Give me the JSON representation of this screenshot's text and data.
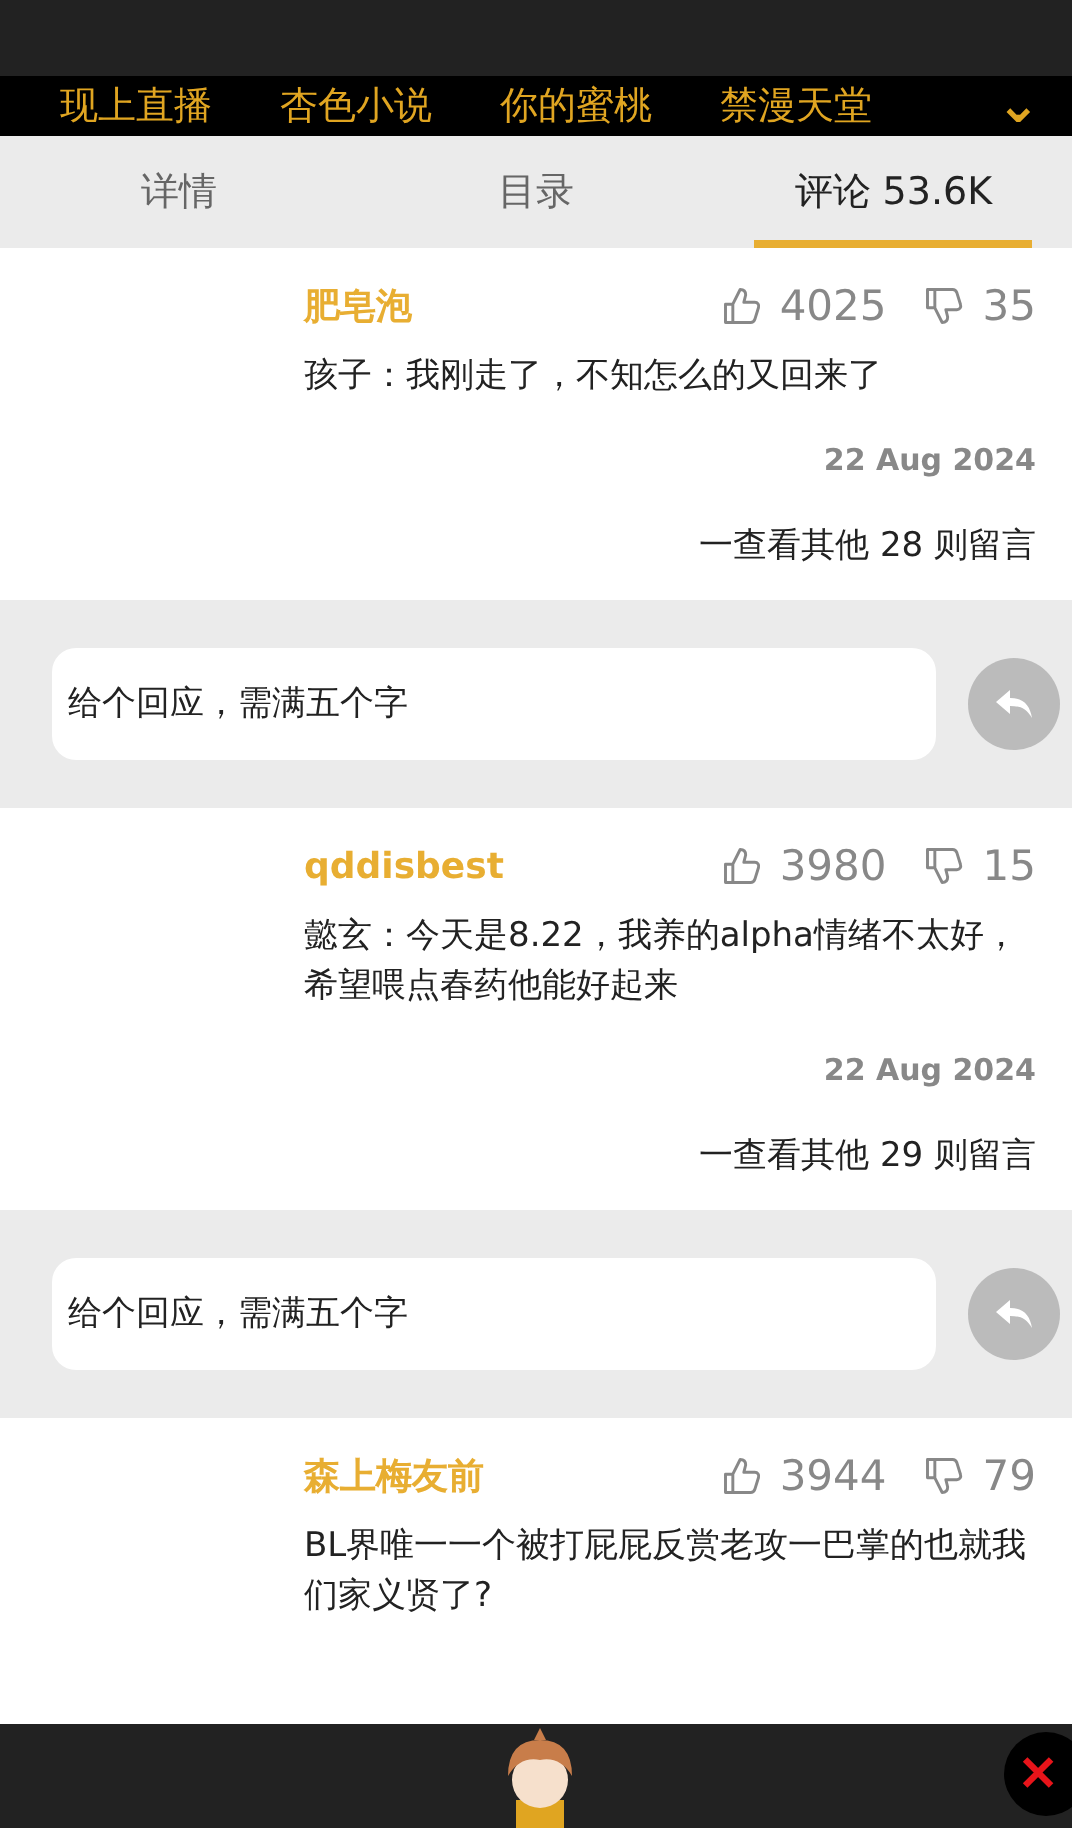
{
  "nav": {
    "items": [
      {
        "label": "现上直播"
      },
      {
        "label": "杏色小说"
      },
      {
        "label": "你的蜜桃"
      },
      {
        "label": "禁漫天堂"
      }
    ],
    "expand_icon": "⌄"
  },
  "tabs": [
    {
      "label": "详情",
      "selected": false
    },
    {
      "label": "目录",
      "selected": false
    },
    {
      "label": "评论 53.6K",
      "selected": true
    }
  ],
  "comments": [
    {
      "user": "肥皂泡",
      "likes": "4025",
      "dislikes": "35",
      "text": "孩子：我刚走了，不知怎么的又回来了",
      "date": "22 Aug 2024",
      "more": "一查看其他 28 则留言",
      "reply_placeholder": "给个回应，需满五个字"
    },
    {
      "user": "qddisbest",
      "likes": "3980",
      "dislikes": "15",
      "text": "懿玄：今天是8.22，我养的alpha情绪不太好，希望喂点春药他能好起来",
      "date": "22 Aug 2024",
      "more": "一查看其他 29 则留言",
      "reply_placeholder": "给个回应，需满五个字"
    },
    {
      "user": "森上梅友前",
      "likes": "3944",
      "dislikes": "79",
      "text": "BL界唯一一个被打屁屁反赏老攻一巴掌的也就我们家义贤了?"
    }
  ],
  "close_label": "✕"
}
